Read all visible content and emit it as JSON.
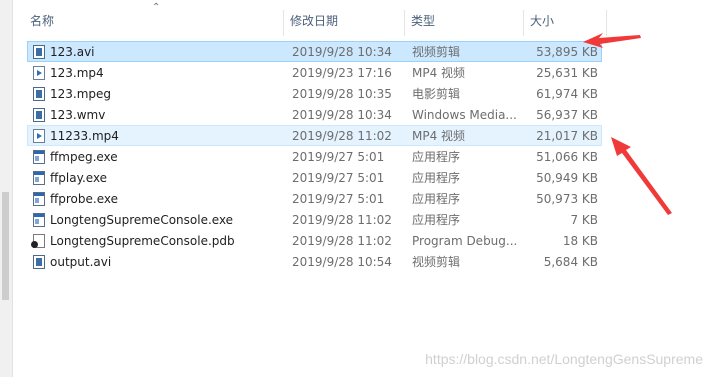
{
  "columns": {
    "name": "名称",
    "date": "修改日期",
    "type": "类型",
    "size": "大小"
  },
  "files": [
    {
      "name": "123.avi",
      "date": "2019/9/28 10:34",
      "type": "视频剪辑",
      "size": "53,895 KB",
      "icon": "video-file-icon",
      "state": "selected"
    },
    {
      "name": "123.mp4",
      "date": "2019/9/23 17:16",
      "type": "MP4 视频",
      "size": "25,631 KB",
      "icon": "mp4-file-icon",
      "state": ""
    },
    {
      "name": "123.mpeg",
      "date": "2019/9/28 10:35",
      "type": "电影剪辑",
      "size": "61,974 KB",
      "icon": "video-file-icon",
      "state": ""
    },
    {
      "name": "123.wmv",
      "date": "2019/9/28 10:34",
      "type": "Windows Media...",
      "size": "56,937 KB",
      "icon": "video-file-icon",
      "state": ""
    },
    {
      "name": "11233.mp4",
      "date": "2019/9/28 11:02",
      "type": "MP4 视频",
      "size": "21,017 KB",
      "icon": "mp4-file-icon",
      "state": "hovered"
    },
    {
      "name": "ffmpeg.exe",
      "date": "2019/9/27 5:01",
      "type": "应用程序",
      "size": "51,066 KB",
      "icon": "exe-file-icon",
      "state": ""
    },
    {
      "name": "ffplay.exe",
      "date": "2019/9/27 5:01",
      "type": "应用程序",
      "size": "50,949 KB",
      "icon": "exe-file-icon",
      "state": ""
    },
    {
      "name": "ffprobe.exe",
      "date": "2019/9/27 5:01",
      "type": "应用程序",
      "size": "50,973 KB",
      "icon": "exe-file-icon",
      "state": ""
    },
    {
      "name": "LongtengSupremeConsole.exe",
      "date": "2019/9/28 11:02",
      "type": "应用程序",
      "size": "7 KB",
      "icon": "exe-file-icon",
      "state": ""
    },
    {
      "name": "LongtengSupremeConsole.pdb",
      "date": "2019/9/28 11:02",
      "type": "Program Debug...",
      "size": "18 KB",
      "icon": "pdb-file-icon",
      "state": ""
    },
    {
      "name": "output.avi",
      "date": "2019/9/28 10:54",
      "type": "视频剪辑",
      "size": "5,684 KB",
      "icon": "video-file-icon",
      "state": ""
    }
  ],
  "watermark": "https://blog.csdn.net/LongtengGensSupreme",
  "colors": {
    "selected_bg": "#cce8ff",
    "hover_bg": "#e5f3ff",
    "annotation_arrow": "#f03a3a"
  }
}
